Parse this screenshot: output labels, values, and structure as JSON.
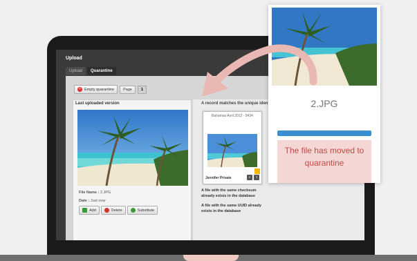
{
  "app": {
    "title": "Upload"
  },
  "tabs": [
    {
      "label": "Upload",
      "active": false
    },
    {
      "label": "Quarantine",
      "active": true
    }
  ],
  "toolbar": {
    "empty_label": "Empty quarantine",
    "page_label": "Page",
    "page_number": "1"
  },
  "left_panel": {
    "heading": "Last uploaded version",
    "file_name_label": "File Name :",
    "file_name": "2.JPG",
    "date_label": "Date :",
    "date": "Just now",
    "actions": [
      {
        "label": "Add",
        "icon": "add-icon",
        "color": "#3a9a3a"
      },
      {
        "label": "Delete",
        "icon": "delete-icon",
        "color": "#d33333"
      },
      {
        "label": "Substitute",
        "icon": "substitute-icon",
        "color": "#3a9a3a"
      }
    ]
  },
  "right_panel": {
    "heading": "A record matches the unique identi",
    "card": {
      "title": "Bahamas Avril 2012 - 8434",
      "owner": "Jennifer Private"
    },
    "notes": [
      "A file with the same checksum already exists in the database",
      "A file with the same UUID already exists in the database"
    ]
  },
  "popup": {
    "file_name": "2.JPG",
    "progress": 1.0,
    "message": "The file has moved to quarantine",
    "progress_color": "#3b8fd0",
    "message_color": "#c24a44"
  }
}
